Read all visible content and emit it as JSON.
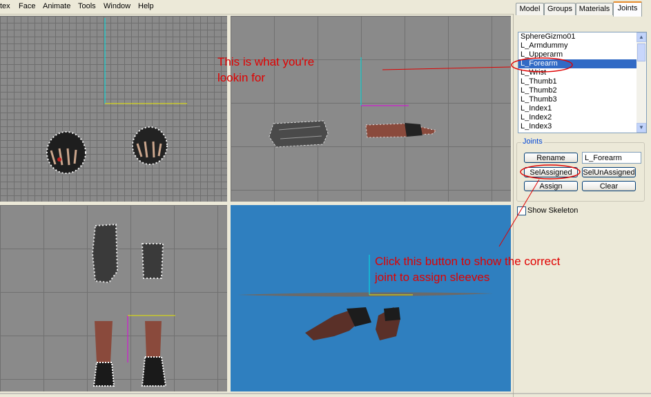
{
  "menu": [
    "tex",
    "Face",
    "Animate",
    "Tools",
    "Window",
    "Help"
  ],
  "tabs": [
    "Model",
    "Groups",
    "Materials",
    "Joints"
  ],
  "active_tab": "Joints",
  "joints_list": [
    "SphereGizmo01",
    "L_Armdummy",
    "L_Upperarm",
    "L_Forearm",
    "L_Wrist",
    "L_Thumb1",
    "L_Thumb2",
    "L_Thumb3",
    "L_Index1",
    "L_Index2",
    "L_Index3"
  ],
  "selected_joint": "L_Forearm",
  "joints_group": {
    "label": "Joints",
    "rename": "Rename",
    "name_value": "L_Forearm",
    "sel_assigned": "SelAssigned",
    "sel_unassigned": "SelUnAssigned",
    "assign": "Assign",
    "clear": "Clear"
  },
  "show_skeleton": {
    "label": "Show Skeleton",
    "checked": false
  },
  "annotations": {
    "forearm_note_1": "This is what you're",
    "forearm_note_2": "lookin for",
    "button_note_1": "Click this button to show the correct",
    "button_note_2": "joint to assign sleeves"
  },
  "colors": {
    "annotation": "#e00000",
    "axis_cyan": "#00e5e5",
    "axis_yellow": "#e5e500",
    "axis_magenta": "#e000e0",
    "selection": "#316ac5",
    "viewport_persp": "#2f7fbf"
  }
}
